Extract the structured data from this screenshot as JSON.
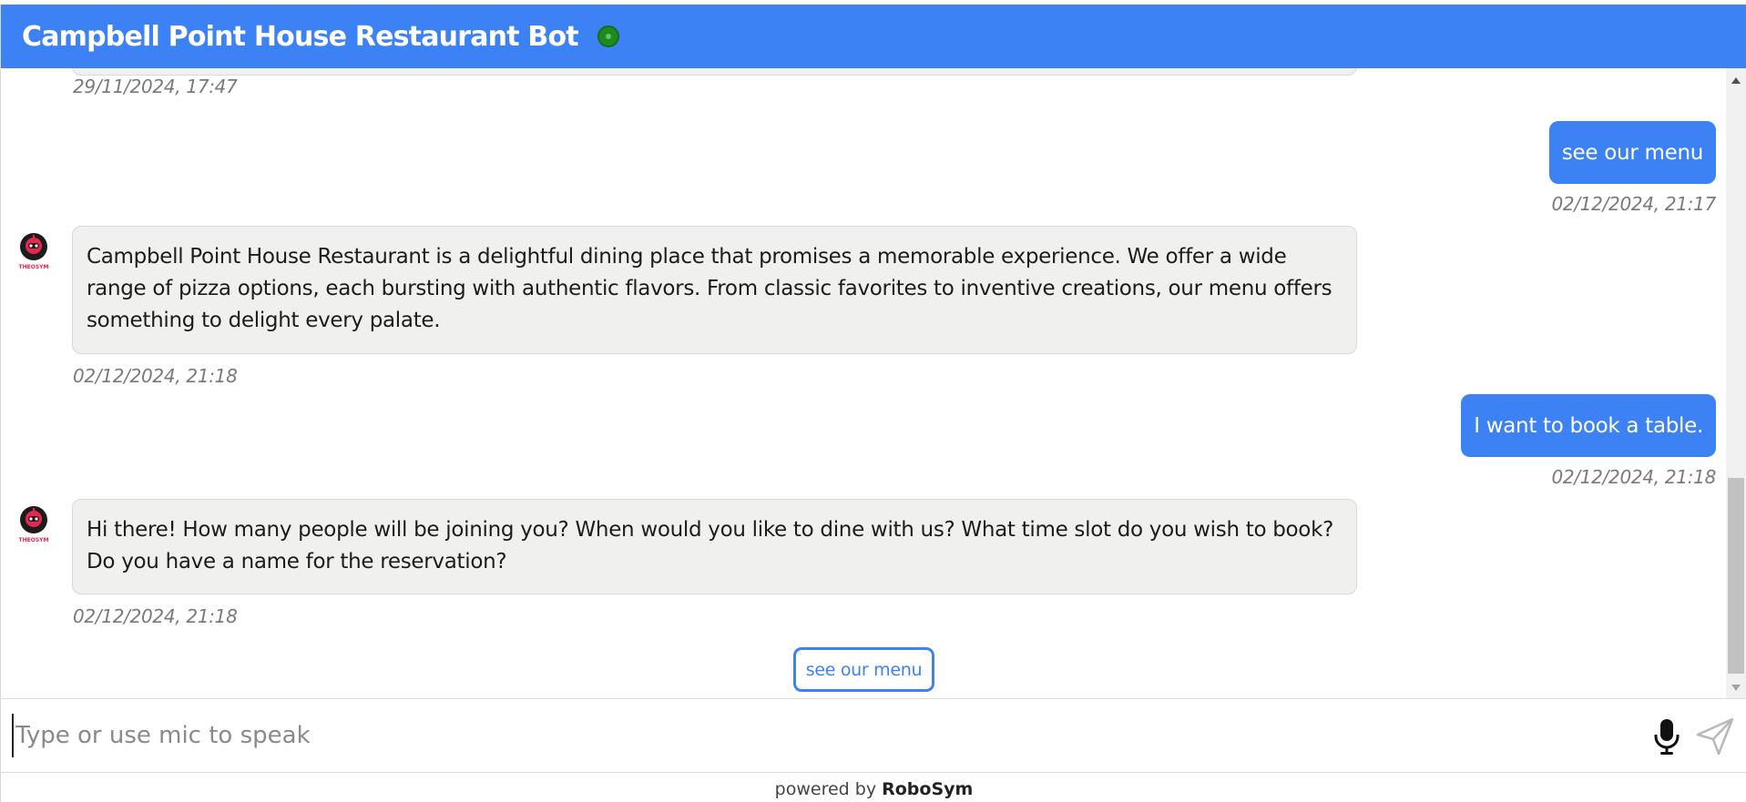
{
  "header": {
    "title": "Campbell Point House Restaurant Bot",
    "status_color": "#1f8a1f"
  },
  "messages": [
    {
      "sender": "bot",
      "text": "",
      "timestamp": "29/11/2024, 17:47"
    },
    {
      "sender": "user",
      "text": "see our menu",
      "timestamp": "02/12/2024, 21:17"
    },
    {
      "sender": "bot",
      "text": "Campbell Point House Restaurant is a delightful dining place that promises a memorable experience. We offer a wide range of pizza options, each bursting with authentic flavors. From classic favorites to inventive creations, our menu offers something to delight every palate.",
      "timestamp": "02/12/2024, 21:18"
    },
    {
      "sender": "user",
      "text": "I want to book a table.",
      "timestamp": "02/12/2024, 21:18"
    },
    {
      "sender": "bot",
      "text": "Hi there! How many people will be joining you? When would you like to dine with us? What time slot do you wish to book? Do you have a name for the reservation?",
      "timestamp": "02/12/2024, 21:18"
    }
  ],
  "avatar": {
    "label": "THEOSYM",
    "icon": "robot-logo-icon"
  },
  "quick_reply": {
    "label": "see our menu"
  },
  "input": {
    "placeholder": "Type or use mic to speak",
    "value": ""
  },
  "icons": {
    "mic": "microphone-icon",
    "send": "send-icon"
  },
  "footer": {
    "prefix": "powered by",
    "brand": "RoboSym"
  },
  "colors": {
    "accent": "#3d82f4",
    "bot_bubble": "#f0f0ef"
  }
}
